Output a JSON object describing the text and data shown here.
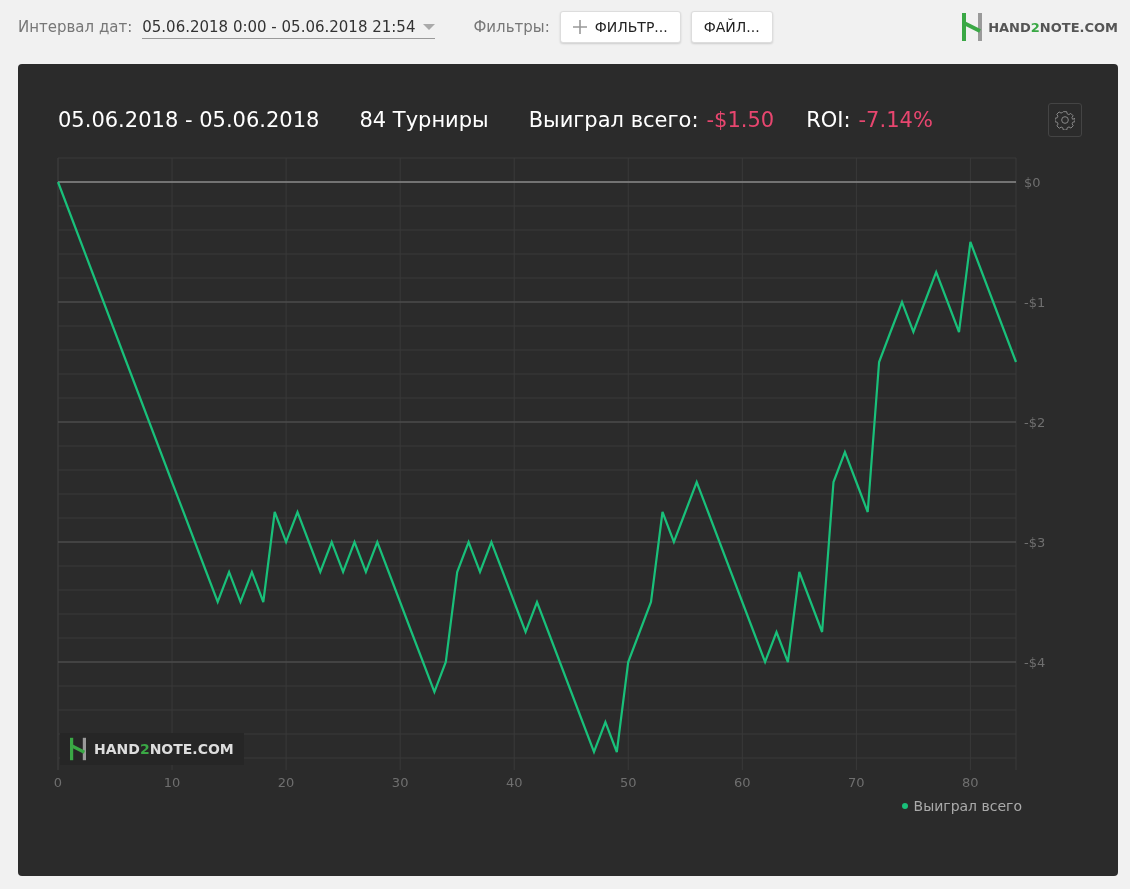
{
  "toolbar": {
    "date_label": "Интервал дат:",
    "date_value": "05.06.2018 0:00 - 05.06.2018 21:54",
    "filters_label": "Фильтры:",
    "buttons": [
      {
        "label": "ФИЛЬТР...",
        "kind": "add"
      },
      {
        "label": "ФАЙЛ...",
        "kind": "plain"
      }
    ],
    "logo": {
      "prefix": "HAND",
      "accent": "2",
      "suffix": "NOTE.COM"
    }
  },
  "summary": {
    "period": "05.06.2018 - 05.06.2018",
    "tournaments": "84 Турниры",
    "won_label": "Выиграл всего:",
    "won_value": "-$1.50",
    "roi_label": "ROI:",
    "roi_value": "-7.14%"
  },
  "chart_watermark": {
    "prefix": "HAND",
    "accent": "2",
    "suffix": "NOTE.COM"
  },
  "chart_data": {
    "type": "line",
    "grid": true,
    "xlim": [
      0,
      84
    ],
    "ylim": [
      -4.9,
      0.2
    ],
    "xticks": [
      0,
      10,
      20,
      30,
      40,
      50,
      60,
      70,
      80
    ],
    "yticks": [
      {
        "value": 0,
        "label": "$0"
      },
      {
        "value": -1,
        "label": "-$1"
      },
      {
        "value": -2,
        "label": "-$2"
      },
      {
        "value": -3,
        "label": "-$3"
      },
      {
        "value": -4,
        "label": "-$4"
      }
    ],
    "x": [
      0,
      1,
      2,
      3,
      4,
      5,
      6,
      7,
      8,
      9,
      10,
      11,
      12,
      13,
      14,
      15,
      16,
      17,
      18,
      19,
      20,
      21,
      22,
      23,
      24,
      25,
      26,
      27,
      28,
      29,
      30,
      31,
      32,
      33,
      34,
      35,
      36,
      37,
      38,
      39,
      40,
      41,
      42,
      43,
      44,
      45,
      46,
      47,
      48,
      49,
      50,
      51,
      52,
      53,
      54,
      55,
      56,
      57,
      58,
      59,
      60,
      61,
      62,
      63,
      64,
      65,
      66,
      67,
      68,
      69,
      70,
      71,
      72,
      73,
      74,
      75,
      76,
      77,
      78,
      79,
      80,
      81,
      82,
      83,
      84
    ],
    "series": [
      {
        "name": "Выиграл всего",
        "color": "#19c07a",
        "values": [
          0,
          -0.25,
          -0.5,
          -0.75,
          -1,
          -1.25,
          -1.5,
          -1.75,
          -2,
          -2.25,
          -2.5,
          -2.75,
          -3,
          -3.25,
          -3.5,
          -3.25,
          -3.5,
          -3.25,
          -3.5,
          -2.75,
          -3,
          -2.75,
          -3,
          -3.25,
          -3,
          -3.25,
          -3,
          -3.25,
          -3,
          -3.25,
          -3.5,
          -3.75,
          -4,
          -4.25,
          -4,
          -3.25,
          -3,
          -3.25,
          -3,
          -3.25,
          -3.5,
          -3.75,
          -3.5,
          -3.75,
          -4,
          -4.25,
          -4.5,
          -4.75,
          -4.5,
          -4.75,
          -4,
          -3.75,
          -3.5,
          -2.75,
          -3,
          -2.75,
          -2.5,
          -2.75,
          -3,
          -3.25,
          -3.5,
          -3.75,
          -4,
          -3.75,
          -4,
          -3.25,
          -3.5,
          -3.75,
          -2.5,
          -2.25,
          -2.5,
          -2.75,
          -1.5,
          -1.25,
          -1,
          -1.25,
          -1,
          -0.75,
          -1,
          -1.25,
          -0.5,
          -0.75,
          -1,
          -1.25,
          -1.5
        ]
      }
    ]
  }
}
